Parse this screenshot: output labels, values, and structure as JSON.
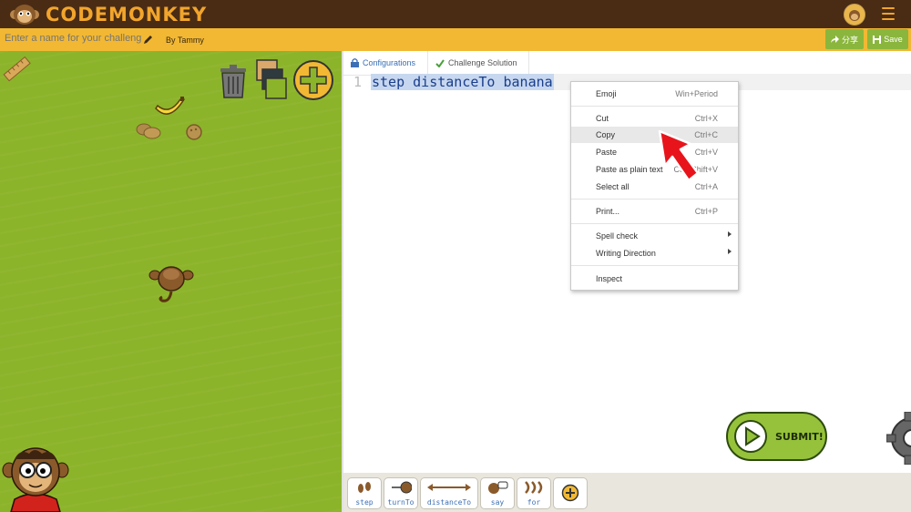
{
  "header": {
    "logo_text": "CODEMONKEY",
    "share_label": "分享",
    "save_label": "Save"
  },
  "challenge": {
    "name_placeholder": "Enter a name for your challenge",
    "author": "By Tammy"
  },
  "editor": {
    "tabs": [
      {
        "label": "Configurations",
        "icon": "lock-icon"
      },
      {
        "label": "Challenge Solution",
        "icon": "checkmark-icon"
      }
    ],
    "line_number": "1",
    "code_line": "step distanceTo banana"
  },
  "context_menu": {
    "items": [
      {
        "label": "Emoji",
        "shortcut": "Win+Period"
      },
      {
        "label": "Cut",
        "shortcut": "Ctrl+X"
      },
      {
        "label": "Copy",
        "shortcut": "Ctrl+C"
      },
      {
        "label": "Paste",
        "shortcut": "Ctrl+V"
      },
      {
        "label": "Paste as plain text",
        "shortcut": "Ctrl+Shift+V"
      },
      {
        "label": "Select all",
        "shortcut": "Ctrl+A"
      },
      {
        "label": "Print...",
        "shortcut": "Ctrl+P"
      },
      {
        "label": "Spell check",
        "shortcut": ""
      },
      {
        "label": "Writing Direction",
        "shortcut": ""
      },
      {
        "label": "Inspect",
        "shortcut": ""
      }
    ],
    "highlighted": "Copy"
  },
  "blocks": [
    "step",
    "turnTo",
    "distanceTo",
    "say",
    "for"
  ],
  "submit_label": "SUBMIT!",
  "colors": {
    "topbar": "#4a2c14",
    "namebar": "#f2b833",
    "grass": "#8cb42a",
    "accent_green": "#8ab63d",
    "pointer_arrow": "#e8141c"
  }
}
